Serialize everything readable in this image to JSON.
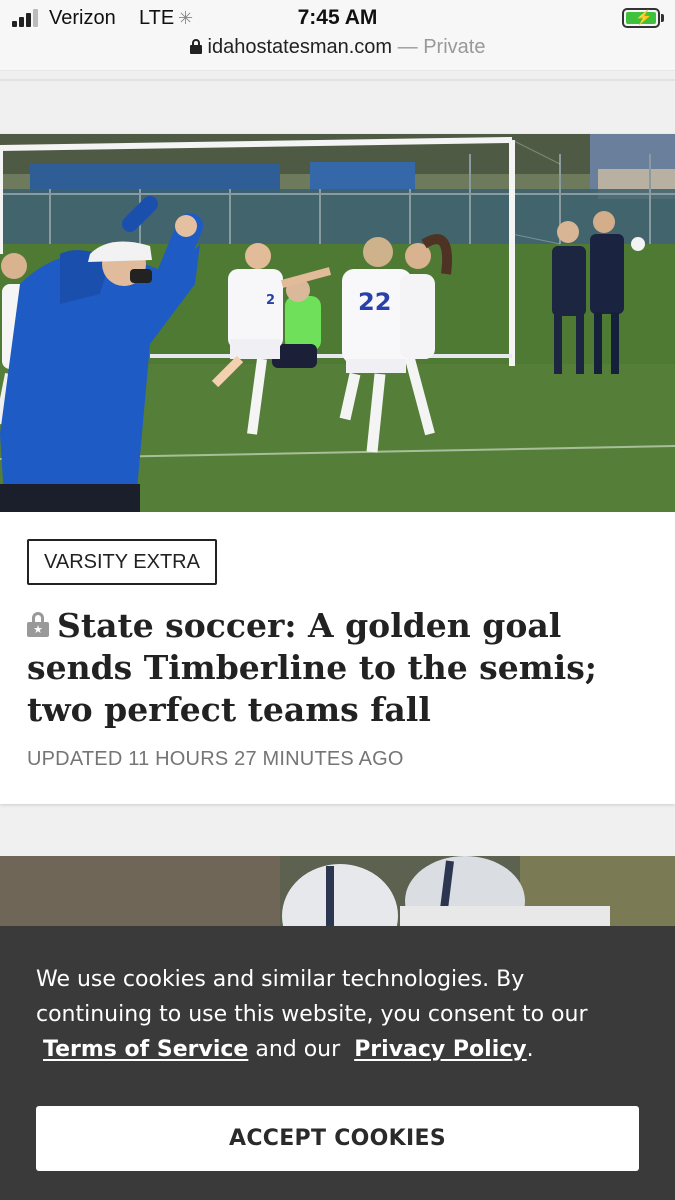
{
  "status_bar": {
    "carrier": "Verizon",
    "network": "LTE",
    "activity_icon": "loading-spinner-icon",
    "time": "7:45 AM",
    "battery_state": "charging",
    "battery_color": "#3ec23e"
  },
  "url_bar": {
    "domain": "idahostatesman.com",
    "mode": "— Private"
  },
  "story": {
    "section": "VARSITY EXTRA",
    "headline": "State soccer: A golden goal sends Timberline to the semis; two perfect teams fall",
    "premium_icon": "premium-lock-icon",
    "updated": "UPDATED 11 HOURS 27 MINUTES AGO",
    "image_jersey_numbers": [
      "2",
      "22"
    ]
  },
  "cookie_banner": {
    "text_before": "We use cookies and similar technologies. By continuing to use this website, you consent to our",
    "terms_label": "Terms of Service",
    "and_text": "and our",
    "privacy_label": "Privacy Policy",
    "end_text": ".",
    "accept_label": "ACCEPT COOKIES"
  },
  "colors": {
    "banner_bg": "#3a3a3a",
    "page_bg": "#f0f0f0",
    "coat_blue": "#1f5bc4",
    "field_green": "#4f7a34"
  }
}
